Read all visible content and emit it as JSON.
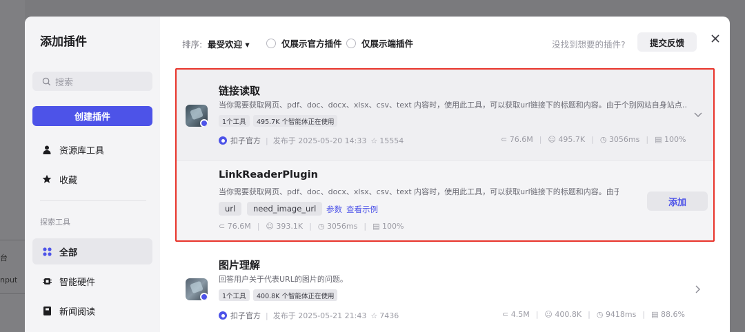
{
  "backdrop": {
    "frag1": "台",
    "frag2": "nput"
  },
  "sidebar": {
    "title": "添加插件",
    "search_placeholder": "搜索",
    "create_button": "创建插件",
    "items": [
      {
        "label": "资源库工具",
        "icon": "user-icon"
      },
      {
        "label": "收藏",
        "icon": "star-icon"
      }
    ],
    "section_label": "探索工具",
    "categories": [
      {
        "label": "全部",
        "icon": "grid-icon",
        "active": true
      },
      {
        "label": "智能硬件",
        "icon": "chip-icon",
        "active": false
      },
      {
        "label": "新闻阅读",
        "icon": "book-icon",
        "active": false
      }
    ]
  },
  "topbar": {
    "sort_label": "排序:",
    "sort_value": "最受欢迎 ▾",
    "radio_official": "仅展示官方插件",
    "radio_client": "仅展示端插件",
    "notfound_text": "没找到想要的插件?",
    "feedback_button": "提交反馈",
    "close_icon": "close-icon"
  },
  "plugins": [
    {
      "title": "链接读取",
      "description": "当你需要获取网页、pdf、doc、docx、xlsx、csv、text 内容时，使用此工具，可以获取url链接下的标题和内容。由于个别网站自身站点…",
      "tags": [
        "1个工具",
        "495.7K 个智能体正在使用"
      ],
      "publisher": "扣子官方",
      "published": "发布于 2025-05-20 14:33",
      "favorites": "15554",
      "stats": [
        "76.6M",
        "495.7K",
        "3056ms",
        "100%"
      ],
      "tool": {
        "title": "LinkReaderPlugin",
        "description": "当你需要获取网页、pdf、doc、docx、xlsx、csv、text 内容时，使用此工具，可以获取url链接下的标题和内容。由于…",
        "params": [
          "url",
          "need_image_url"
        ],
        "param_link": "参数",
        "example_link": "查看示例",
        "stats": [
          "76.6M",
          "393.1K",
          "3056ms",
          "100%"
        ],
        "add_button": "添加"
      }
    },
    {
      "title": "图片理解",
      "description": "回答用户关于代表URL的图片的问题。",
      "tags": [
        "1个工具",
        "400.8K 个智能体正在使用"
      ],
      "publisher": "扣子官方",
      "published": "发布于 2025-05-21 21:43",
      "favorites": "7436",
      "stats": [
        "4.5M",
        "400.8K",
        "9418ms",
        "88.6%"
      ]
    }
  ],
  "colors": {
    "accent": "#4d53e8",
    "highlight_border": "#e8332a"
  }
}
